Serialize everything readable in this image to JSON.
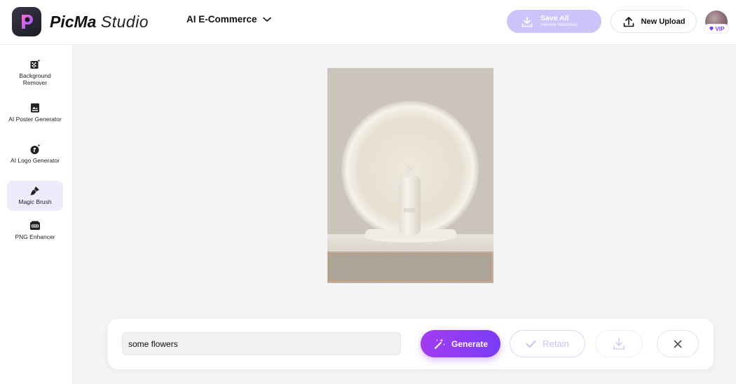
{
  "header": {
    "brand_bold": "PicMa",
    "brand_light": "Studio",
    "mode_label": "AI E-Commerce",
    "save_all": {
      "title": "Save All",
      "subtitle": "Remove Watermark"
    },
    "new_upload_label": "New Upload",
    "vip_label": "VIP"
  },
  "sidebar": {
    "items": [
      {
        "label": "Background Remover",
        "icon": "background-remover-icon"
      },
      {
        "label": "AI Poster Generator",
        "icon": "poster-icon"
      },
      {
        "label": "AI Logo Generator",
        "icon": "logo-icon"
      },
      {
        "label": "Magic Brush",
        "icon": "brush-icon",
        "active": true
      },
      {
        "label": "PNG Enhancer",
        "icon": "png-icon"
      }
    ]
  },
  "prompt_panel": {
    "input_value": "some flowers",
    "generate_label": "Generate",
    "retain_label": "Retain"
  },
  "colors": {
    "accent": "#7a3cf5",
    "accent_light": "#cfc3fb",
    "mask_border": "#e08a5c"
  }
}
